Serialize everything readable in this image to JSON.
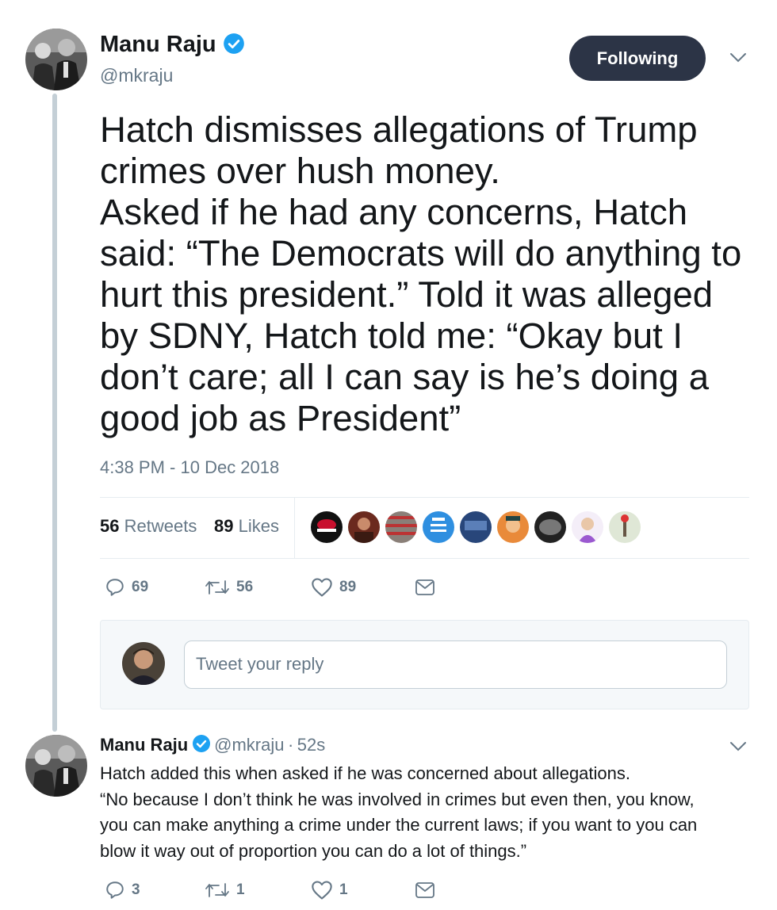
{
  "tweet": {
    "author_name": "Manu Raju",
    "author_handle": "@mkraju",
    "follow_label": "Following",
    "text_lines": [
      "Hatch dismisses allegations of Trump",
      "crimes over hush money.",
      "Asked if he had any concerns, Hatch",
      "said: “The Democrats will do anything to",
      "hurt this president.” Told it was alleged",
      "by SDNY, Hatch told me: “Okay but I",
      "don’t care; all I can say is he’s doing a",
      "good job as President”"
    ],
    "timestamp": "4:38 PM - 10 Dec 2018",
    "retweets_count": "56",
    "retweets_label": "Retweets",
    "likes_count": "89",
    "likes_label": "Likes",
    "actions": {
      "replies": "69",
      "retweets": "56",
      "likes": "89"
    }
  },
  "reply_box": {
    "placeholder": "Tweet your reply"
  },
  "reply": {
    "author_name": "Manu Raju",
    "author_handle": "@mkraju",
    "separator": "·",
    "time": "52s",
    "text_lines": [
      "Hatch added this when asked if he was concerned about allegations.",
      "“No because I don’t think he was involved in crimes but even then, you know,",
      "you can make anything a crime under the current laws; if you want to you can",
      "blow it way out of proportion you can do a lot of things.”"
    ],
    "actions": {
      "replies": "3",
      "retweets": "1",
      "likes": "1"
    }
  },
  "colors": {
    "verified": "#1da1f2",
    "follow_button_bg": "#2c3446",
    "secondary_text": "#657786",
    "thread_line": "#c4cfd6"
  },
  "icons": [
    "verified-icon",
    "chevron-down-icon",
    "reply-icon",
    "retweet-icon",
    "like-icon",
    "message-icon"
  ]
}
